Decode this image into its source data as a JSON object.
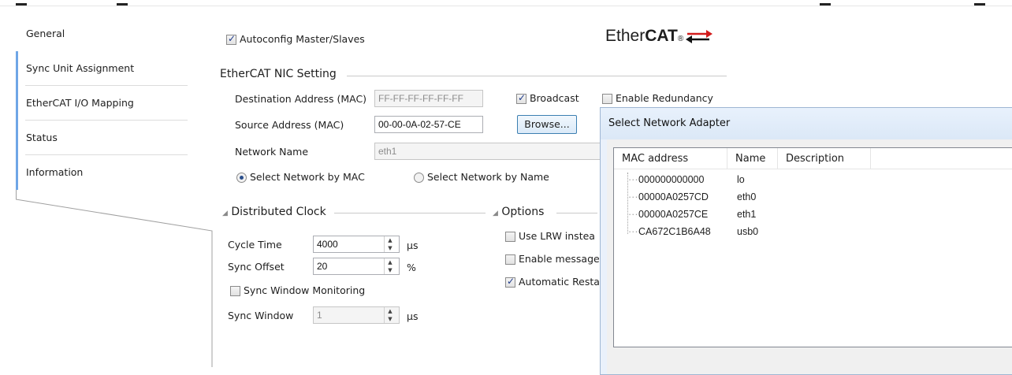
{
  "tabs": [
    {
      "label": "General",
      "active": true
    },
    {
      "label": "Sync Unit Assignment",
      "active": false
    },
    {
      "label": "EtherCAT I/O Mapping",
      "active": false
    },
    {
      "label": "Status",
      "active": false
    },
    {
      "label": "Information",
      "active": false
    }
  ],
  "general": {
    "autoconfig_label": "Autoconfig Master/Slaves",
    "autoconfig_checked": true,
    "logo_text_plain": "Ether",
    "logo_text_bold": "CAT",
    "logo_mark": "®",
    "nic_title": "EtherCAT NIC Setting",
    "dest_label": "Destination Address (MAC)",
    "dest_value": "FF-FF-FF-FF-FF-FF",
    "broadcast_label": "Broadcast",
    "broadcast_checked": true,
    "redundancy_label": "Enable Redundancy",
    "redundancy_checked": false,
    "source_label": "Source Address (MAC)",
    "source_value": "00-00-0A-02-57-CE",
    "browse_label": "Browse...",
    "network_name_label": "Network Name",
    "network_name_value": "eth1",
    "radio_mac_label": "Select Network by MAC",
    "radio_name_label": "Select Network by Name",
    "dc_title": "Distributed Clock",
    "options_title": "Options",
    "cycle_label": "Cycle Time",
    "cycle_value": "4000",
    "cycle_unit": "µs",
    "sync_offset_label": "Sync Offset",
    "sync_offset_value": "20",
    "sync_offset_unit": "%",
    "sync_window_mon_label": "Sync Window Monitoring",
    "sync_window_label": "Sync Window",
    "sync_window_value": "1",
    "sync_window_unit": "µs",
    "opt_lrw_label": "Use LRW instea",
    "opt_msg_label": "Enable message",
    "opt_restart_label": "Automatic Resta"
  },
  "dialog": {
    "title": "Select Network Adapter",
    "columns": [
      "MAC address",
      "Name",
      "Description"
    ],
    "rows": [
      {
        "mac": "000000000000",
        "name": "lo"
      },
      {
        "mac": "00000A0257CD",
        "name": "eth0"
      },
      {
        "mac": "00000A0257CE",
        "name": "eth1"
      },
      {
        "mac": "CA672C1B6A48",
        "name": "usb0"
      }
    ]
  },
  "colors": {
    "accent_blue": "#6fa6e6",
    "logo_red": "#d21b1b",
    "dialog_bg": "#eaf1fb"
  }
}
